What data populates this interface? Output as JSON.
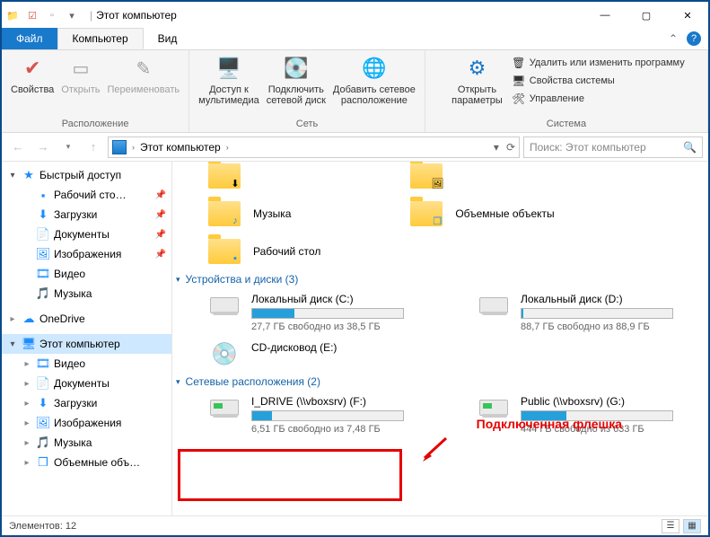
{
  "title": "Этот компьютер",
  "win": {
    "min": "—",
    "max": "▢",
    "close": "✕"
  },
  "tabs": {
    "file": "Файл",
    "computer": "Компьютер",
    "view": "Вид"
  },
  "ribbon": {
    "properties": "Свойства",
    "open": "Открыть",
    "rename": "Переименовать",
    "group1": "Расположение",
    "media": "Доступ к\nмультимедиа",
    "mapdrive": "Подключить\nсетевой диск",
    "addnet": "Добавить сетевое\nрасположение",
    "group2": "Сеть",
    "openparams": "Открыть\nпараметры",
    "uninstall": "Удалить или изменить программу",
    "sysprops": "Свойства системы",
    "manage": "Управление",
    "group3": "Система"
  },
  "address": {
    "crumb": "Этот компьютер",
    "search_placeholder": "Поиск: Этот компьютер"
  },
  "sidebar": {
    "quick": "Быстрый доступ",
    "desktop": "Рабочий сто…",
    "downloads": "Загрузки",
    "documents": "Документы",
    "pictures": "Изображения",
    "videos": "Видео",
    "music": "Музыка",
    "onedrive": "OneDrive",
    "thispc": "Этот компьютер",
    "pc_videos": "Видео",
    "pc_documents": "Документы",
    "pc_downloads": "Загрузки",
    "pc_pictures": "Изображения",
    "pc_music": "Музыка",
    "pc_3d": "Объемные объ…"
  },
  "folders": {
    "music": "Музыка",
    "desktop_f": "Рабочий стол",
    "objects3d": "Объемные объекты"
  },
  "sections": {
    "drives": "Устройства и диски (3)",
    "network": "Сетевые расположения (2)"
  },
  "drives": {
    "c": {
      "name": "Локальный диск (C:)",
      "free": "27,7 ГБ свободно из 38,5 ГБ",
      "fill": 28
    },
    "d": {
      "name": "Локальный диск (D:)",
      "free": "88,7 ГБ свободно из 88,9 ГБ",
      "fill": 1
    },
    "e": {
      "name": "CD-дисковод (E:)"
    },
    "f": {
      "name": "I_DRIVE (\\\\vboxsrv) (F:)",
      "free": "6,51 ГБ свободно из 7,48 ГБ",
      "fill": 13
    },
    "g": {
      "name": "Public (\\\\vboxsrv) (G:)",
      "free": "444 ГБ свободно из 633 ГБ",
      "fill": 30
    }
  },
  "annotation": "Подключенная флешка",
  "status": "Элементов: 12"
}
